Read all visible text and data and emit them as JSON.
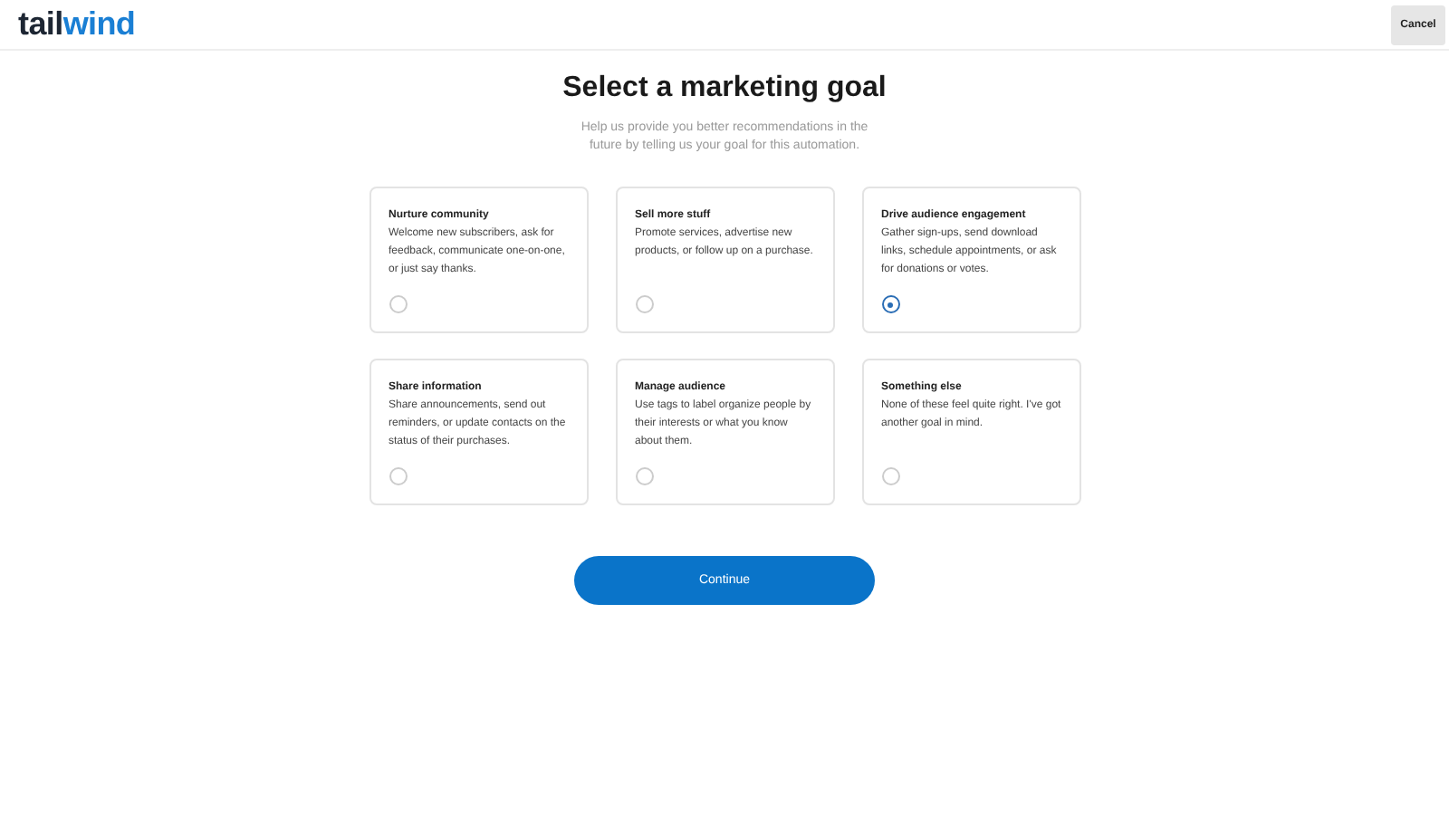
{
  "logo": {
    "part_1": "tail",
    "part_2": "wind"
  },
  "cancel_button": "Cancel",
  "title": "Select a marketing goal",
  "subtitle": "Help us provide you better recommendations in the future by telling us your goal for this automation.",
  "goals": [
    {
      "title": "Nurture community",
      "description": "Welcome new subscribers, ask for feedback, communicate one-on-one, or just say thanks.",
      "selected": false
    },
    {
      "title": "Sell more stuff",
      "description": "Promote services, advertise new products, or follow up on a purchase.",
      "selected": false
    },
    {
      "title": "Drive audience engagement",
      "description": "Gather sign-ups, send download links, schedule appointments, or ask for donations or votes.",
      "selected": true
    },
    {
      "title": "Share information",
      "description": "Share announcements, send out reminders, or update contacts on the status of their purchases.",
      "selected": false
    },
    {
      "title": "Manage audience",
      "description": "Use tags to label organize people by their interests or what you know about them.",
      "selected": false
    },
    {
      "title": "Something else",
      "description": "None of these feel quite right. I've got another goal in mind.",
      "selected": false
    }
  ],
  "continue_button": "Continue"
}
